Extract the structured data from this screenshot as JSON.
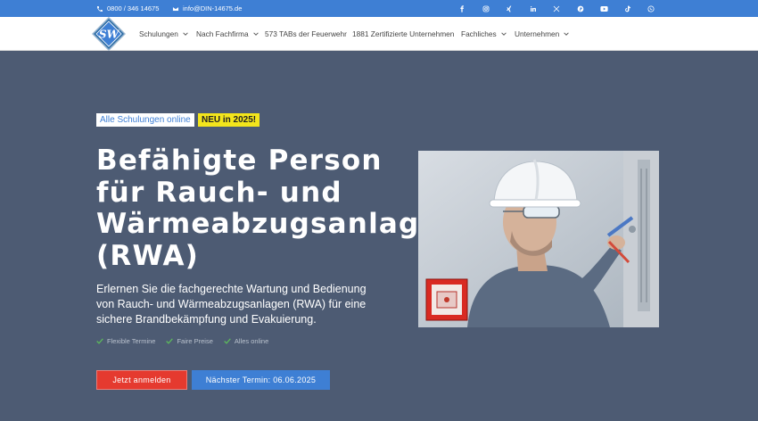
{
  "topbar": {
    "phone": "0800 / 346 14675",
    "email": "info@DIN-14675.de",
    "socials": [
      "facebook-icon",
      "instagram-icon",
      "xing-icon",
      "linkedin-icon",
      "x-icon",
      "pinterest-icon",
      "youtube-icon",
      "tiktok-icon",
      "whatsapp-icon"
    ]
  },
  "nav": {
    "logo_text": "SW",
    "items": [
      {
        "label": "Schulungen",
        "dropdown": true
      },
      {
        "label": "Nach Fachfirma",
        "dropdown": true
      },
      {
        "label": "573 TABs der Feuerwehr",
        "dropdown": false
      },
      {
        "label": "1881 Zertifizierte Unternehmen",
        "dropdown": false
      },
      {
        "label": "Fachliches",
        "dropdown": true
      },
      {
        "label": "Unternehmen",
        "dropdown": true
      }
    ]
  },
  "hero": {
    "badge_online": "Alle Schulungen online",
    "badge_new": "NEU in 2025!",
    "title_lines": [
      "Befähigte Person",
      "für Rauch- und",
      "Wärmeabzugsanlagen",
      "(RWA)"
    ],
    "subtitle": "Erlernen Sie die fachgerechte Wartung und Bedienung von Rauch- und Wärmeabzugsanlagen (RWA) für eine sichere Brandbekämpfung und Evakuierung.",
    "features": [
      "Flexible Termine",
      "Faire Preise",
      "Alles online"
    ],
    "cta_primary": "Jetzt anmelden",
    "cta_secondary": "Nächster Termin: 06.06.2025"
  },
  "colors": {
    "accent_blue": "#3e7fd4",
    "hero_bg": "#4d5b73",
    "cta_red": "#e53a2f",
    "badge_yellow": "#f3e51c",
    "check_green": "#5cb85c"
  }
}
